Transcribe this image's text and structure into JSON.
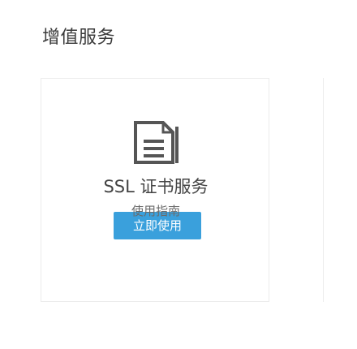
{
  "header": {
    "title": "增值服务"
  },
  "card": {
    "icon": "document-icon",
    "service_name": "SSL 证书服务",
    "action_label": "立即使用",
    "guide_label": "使用指南"
  },
  "colors": {
    "primary_button": "#3aa0dc",
    "border": "#ececec",
    "text": "#444444"
  }
}
